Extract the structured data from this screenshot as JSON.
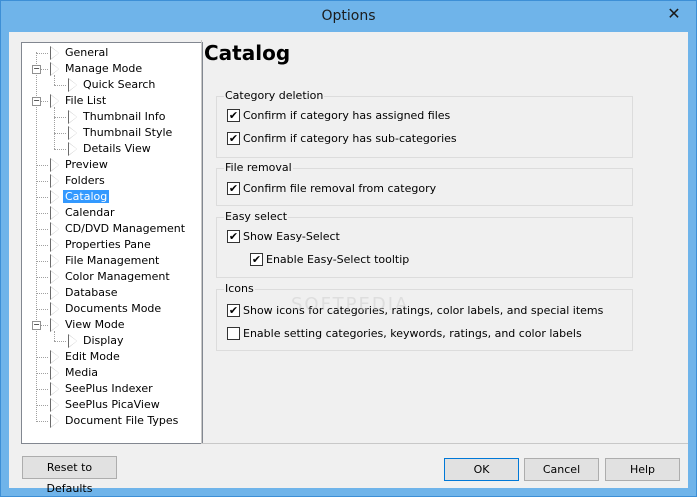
{
  "window": {
    "title": "Options",
    "close_glyph": "✕"
  },
  "tree": {
    "items": [
      {
        "label": "General"
      },
      {
        "label": "Manage Mode",
        "expander": "−"
      },
      {
        "label": "Quick Search"
      },
      {
        "label": "File List",
        "expander": "−"
      },
      {
        "label": "Thumbnail Info"
      },
      {
        "label": "Thumbnail Style"
      },
      {
        "label": "Details View"
      },
      {
        "label": "Preview"
      },
      {
        "label": "Folders"
      },
      {
        "label": "Catalog",
        "selected": true
      },
      {
        "label": "Calendar"
      },
      {
        "label": "CD/DVD Management"
      },
      {
        "label": "Properties Pane"
      },
      {
        "label": "File Management"
      },
      {
        "label": "Color Management"
      },
      {
        "label": "Database"
      },
      {
        "label": "Documents Mode"
      },
      {
        "label": "View Mode",
        "expander": "−"
      },
      {
        "label": "Display"
      },
      {
        "label": "Edit Mode"
      },
      {
        "label": "Media"
      },
      {
        "label": "SeePlus Indexer"
      },
      {
        "label": "SeePlus PicaView"
      },
      {
        "label": "Document File Types"
      }
    ]
  },
  "page": {
    "title": "Catalog"
  },
  "groups": {
    "category_deletion": {
      "title": "Category deletion",
      "options": [
        {
          "label": "Confirm if category has assigned files",
          "checked": true
        },
        {
          "label": "Confirm if category has sub-categories",
          "checked": true
        }
      ]
    },
    "file_removal": {
      "title": "File removal",
      "options": [
        {
          "label": "Confirm file removal from category",
          "checked": true
        }
      ]
    },
    "easy_select": {
      "title": "Easy select",
      "options": [
        {
          "label": "Show Easy-Select",
          "checked": true
        },
        {
          "label": "Enable Easy-Select tooltip",
          "checked": true
        }
      ]
    },
    "icons": {
      "title": "Icons",
      "options": [
        {
          "label": "Show icons for categories, ratings, color labels, and special items",
          "checked": true
        },
        {
          "label": "Enable setting categories, keywords, ratings, and color labels",
          "checked": false
        }
      ]
    }
  },
  "buttons": {
    "reset": "Reset to Defaults",
    "ok": "OK",
    "cancel": "Cancel",
    "help": "Help"
  },
  "watermark": "SOFTPEDIA"
}
